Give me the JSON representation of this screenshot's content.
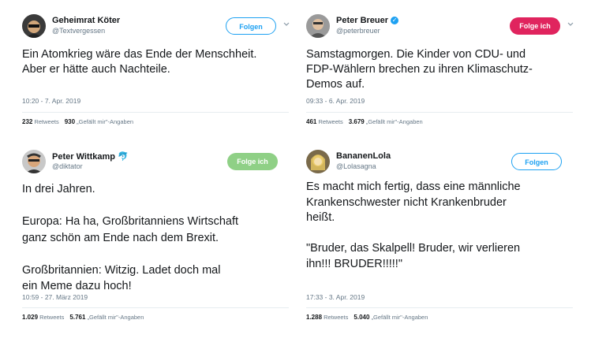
{
  "tweets": [
    {
      "name": "Geheimrat Köter",
      "handle": "@Textvergessen",
      "follow_label": "Folgen",
      "text": "Ein Atomkrieg wäre das Ende der Menschheit.\nAber er hätte auch Nachteile.",
      "timestamp": "10:20 - 7. Apr. 2019",
      "retweets": "232",
      "retweets_label": "Retweets",
      "likes": "930",
      "likes_label": "„Gefällt mir\"-Angaben"
    },
    {
      "name": "Peter Breuer",
      "handle": "@peterbreuer",
      "follow_label": "Folge ich",
      "text": "Samstagmorgen. Die Kinder von CDU- und\nFDP-Wählern brechen zu ihren Klimaschutz-\nDemos auf.",
      "timestamp": "09:33 - 6. Apr. 2019",
      "retweets": "461",
      "retweets_label": "Retweets",
      "likes": "3.679",
      "likes_label": "„Gefällt mir\"-Angaben"
    },
    {
      "name": "Peter Wittkamp",
      "handle": "@diktator",
      "follow_label": "Folge ich",
      "text": "In drei Jahren.\n\nEuropa: Ha ha, Großbritanniens Wirtschaft\nganz schön am Ende nach dem Brexit.\n\nGroßbritannien: Witzig. Ladet doch mal\nein Meme dazu hoch!",
      "timestamp": "10:59 - 27. März 2019",
      "retweets": "1.029",
      "retweets_label": "Retweets",
      "likes": "5.761",
      "likes_label": "„Gefällt mir\"-Angaben"
    },
    {
      "name": "BananenLola",
      "handle": "@Lolasagna",
      "follow_label": "Folgen",
      "text": "Es macht mich fertig, dass eine männliche\nKrankenschwester nicht Krankenbruder\nheißt.\n\n\"Bruder, das Skalpell! Bruder, wir verlieren\nihn!!! BRUDER!!!!!\"",
      "timestamp": "17:33 - 3. Apr. 2019",
      "retweets": "1.288",
      "retweets_label": "Retweets",
      "likes": "5.040",
      "likes_label": "„Gefällt mir\"-Angaben"
    }
  ],
  "colors": {
    "accent": "#1da1f2",
    "follow_red": "#e0245e",
    "follow_green": "#8fd086",
    "muted": "#657786"
  }
}
